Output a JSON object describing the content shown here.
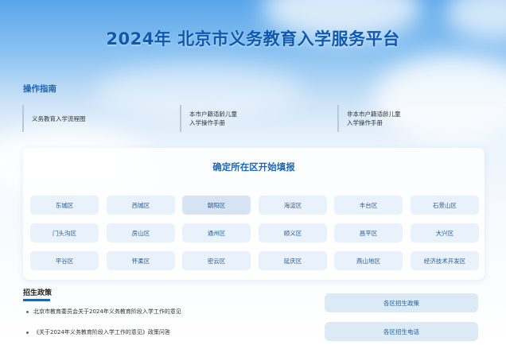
{
  "header": {
    "title": "2024年 北京市义务教育入学服务平台"
  },
  "guide": {
    "heading": "操作指南",
    "links": [
      {
        "label": "义务教育入学流程图"
      },
      {
        "label": "本市户籍适龄儿童\n入学操作手册"
      },
      {
        "label": "非本市户籍适龄儿童\n入学操作手册"
      }
    ]
  },
  "district_card": {
    "title": "确定所在区开始填报",
    "selected": "朝阳区",
    "districts": [
      "东城区",
      "西城区",
      "朝阳区",
      "海淀区",
      "丰台区",
      "石景山区",
      "门头沟区",
      "房山区",
      "通州区",
      "顺义区",
      "昌平区",
      "大兴区",
      "平谷区",
      "怀柔区",
      "密云区",
      "延庆区",
      "燕山地区",
      "经济技术开发区"
    ]
  },
  "policy": {
    "heading": "招生政策",
    "items": [
      "北京市教育委员会关于2024年义务教育阶段入学工作的意见",
      "《关于2024年义务教育阶段入学工作的意见》政策问答"
    ]
  },
  "side_buttons": {
    "enrollment_policy": "各区招生政策",
    "enrollment_phone": "各区招生电话"
  }
}
